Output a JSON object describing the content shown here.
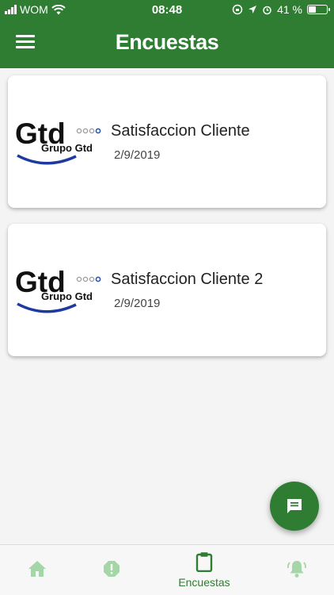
{
  "status_bar": {
    "carrier": "WOM",
    "time": "08:48",
    "battery": "41 %",
    "battery_level": 0.41
  },
  "header": {
    "title": "Encuestas",
    "bg_color": "#2e7d32"
  },
  "surveys": [
    {
      "logo_text": "Gtd",
      "logo_subtext": "Grupo Gtd",
      "title": "Satisfaccion Cliente",
      "date": "2/9/2019"
    },
    {
      "logo_text": "Gtd",
      "logo_subtext": "Grupo Gtd",
      "title": "Satisfaccion Cliente 2",
      "date": "2/9/2019"
    }
  ],
  "fab": {
    "icon": "chat-icon"
  },
  "tabs": [
    {
      "icon": "home-icon",
      "label": ""
    },
    {
      "icon": "alert-circle-icon",
      "label": ""
    },
    {
      "icon": "clipboard-icon",
      "label": "Encuestas",
      "active": true
    },
    {
      "icon": "bell-ring-icon",
      "label": ""
    }
  ],
  "colors": {
    "accent": "#2e7d32",
    "inactive_tab": "#a5d6a7"
  }
}
